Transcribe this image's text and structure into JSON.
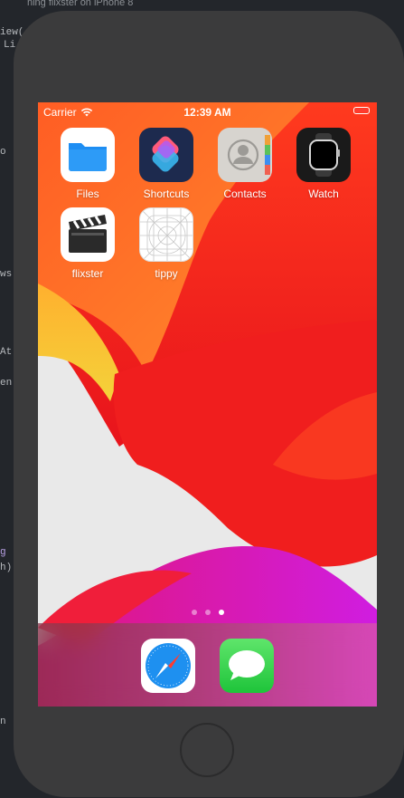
{
  "ide": {
    "title": "ning flixster on iPhone 8",
    "code_lines": [
      "iew(",
      "Li",
      "o",
      "ws",
      "At",
      "en",
      "g",
      "h)",
      "n"
    ]
  },
  "status_bar": {
    "carrier": "Carrier",
    "time": "12:39 AM"
  },
  "home_apps": [
    {
      "label": "Files",
      "icon": "files-icon"
    },
    {
      "label": "Shortcuts",
      "icon": "shortcuts-icon"
    },
    {
      "label": "Contacts",
      "icon": "contacts-icon"
    },
    {
      "label": "Watch",
      "icon": "watch-icon"
    },
    {
      "label": "flixster",
      "icon": "clapperboard-icon"
    },
    {
      "label": "tippy",
      "icon": "app-template-grid-icon"
    }
  ],
  "page_indicator": {
    "pages": 3,
    "current": 3
  },
  "dock_apps": [
    {
      "name": "Safari",
      "icon": "compass-icon"
    },
    {
      "name": "Messages",
      "icon": "speech-bubble-icon"
    }
  ],
  "colors": {
    "wallpaper_red": "#f2251b",
    "wallpaper_orange": "#ff6a2a",
    "battery": "#ff3b30",
    "device_frame": "#3b3b3c"
  }
}
